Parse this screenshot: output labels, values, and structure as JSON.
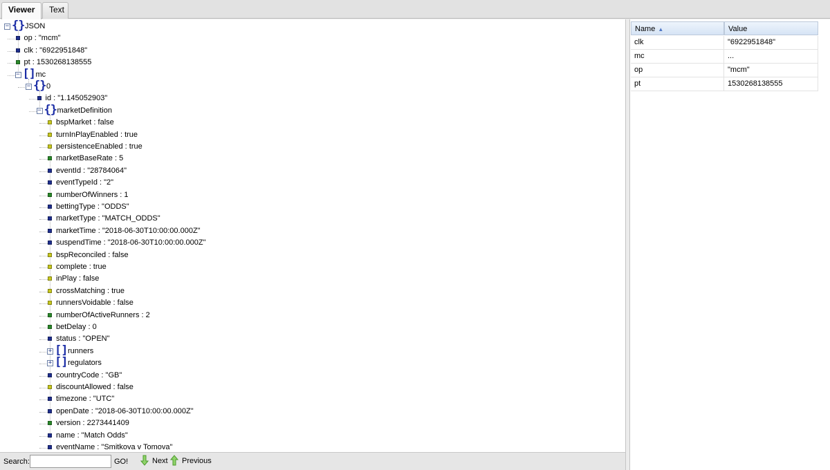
{
  "tabs": [
    {
      "label": "Viewer",
      "active": true
    },
    {
      "label": "Text",
      "active": false
    }
  ],
  "tree": {
    "nodes": [
      {
        "label": "JSON",
        "kind": "object",
        "depth": 0,
        "expanded": true
      },
      {
        "label": "op : \"mcm\"",
        "kind": "string",
        "depth": 1
      },
      {
        "label": "clk : \"6922951848\"",
        "kind": "string",
        "depth": 1
      },
      {
        "label": "pt : 1530268138555",
        "kind": "number",
        "depth": 1
      },
      {
        "label": "mc",
        "kind": "array",
        "depth": 1,
        "expanded": true
      },
      {
        "label": "0",
        "kind": "object",
        "depth": 2,
        "expanded": true
      },
      {
        "label": "id : \"1.145052903\"",
        "kind": "string",
        "depth": 3
      },
      {
        "label": "marketDefinition",
        "kind": "object",
        "depth": 3,
        "expanded": true
      },
      {
        "label": "bspMarket : false",
        "kind": "boolean",
        "depth": 4
      },
      {
        "label": "turnInPlayEnabled : true",
        "kind": "boolean",
        "depth": 4
      },
      {
        "label": "persistenceEnabled : true",
        "kind": "boolean",
        "depth": 4
      },
      {
        "label": "marketBaseRate : 5",
        "kind": "number",
        "depth": 4
      },
      {
        "label": "eventId : \"28784064\"",
        "kind": "string",
        "depth": 4
      },
      {
        "label": "eventTypeId : \"2\"",
        "kind": "string",
        "depth": 4
      },
      {
        "label": "numberOfWinners : 1",
        "kind": "number",
        "depth": 4
      },
      {
        "label": "bettingType : \"ODDS\"",
        "kind": "string",
        "depth": 4
      },
      {
        "label": "marketType : \"MATCH_ODDS\"",
        "kind": "string",
        "depth": 4
      },
      {
        "label": "marketTime : \"2018-06-30T10:00:00.000Z\"",
        "kind": "string",
        "depth": 4
      },
      {
        "label": "suspendTime : \"2018-06-30T10:00:00.000Z\"",
        "kind": "string",
        "depth": 4
      },
      {
        "label": "bspReconciled : false",
        "kind": "boolean",
        "depth": 4
      },
      {
        "label": "complete : true",
        "kind": "boolean",
        "depth": 4
      },
      {
        "label": "inPlay : false",
        "kind": "boolean",
        "depth": 4
      },
      {
        "label": "crossMatching : true",
        "kind": "boolean",
        "depth": 4
      },
      {
        "label": "runnersVoidable : false",
        "kind": "boolean",
        "depth": 4
      },
      {
        "label": "numberOfActiveRunners : 2",
        "kind": "number",
        "depth": 4
      },
      {
        "label": "betDelay : 0",
        "kind": "number",
        "depth": 4
      },
      {
        "label": "status : \"OPEN\"",
        "kind": "string",
        "depth": 4
      },
      {
        "label": "runners",
        "kind": "array",
        "depth": 4,
        "expanded": false
      },
      {
        "label": "regulators",
        "kind": "array",
        "depth": 4,
        "expanded": false
      },
      {
        "label": "countryCode : \"GB\"",
        "kind": "string",
        "depth": 4
      },
      {
        "label": "discountAllowed : false",
        "kind": "boolean",
        "depth": 4
      },
      {
        "label": "timezone : \"UTC\"",
        "kind": "string",
        "depth": 4
      },
      {
        "label": "openDate : \"2018-06-30T10:00:00.000Z\"",
        "kind": "string",
        "depth": 4
      },
      {
        "label": "version : 2273441409",
        "kind": "number",
        "depth": 4
      },
      {
        "label": "name : \"Match Odds\"",
        "kind": "string",
        "depth": 4
      },
      {
        "label": "eventName : \"Smitkova v Tomova\"",
        "kind": "string",
        "depth": 4
      }
    ]
  },
  "search": {
    "label": "Search:",
    "value": "",
    "go_label": "GO!",
    "next_label": "Next",
    "previous_label": "Previous"
  },
  "grid": {
    "header_name": "Name",
    "header_value": "Value",
    "rows": [
      {
        "name": "clk",
        "value": "\"6922951848\""
      },
      {
        "name": "mc",
        "value": "..."
      },
      {
        "name": "op",
        "value": "\"mcm\""
      },
      {
        "name": "pt",
        "value": "1530268138555"
      }
    ]
  },
  "colors": {
    "string": "#1f2f8f",
    "number": "#2a8a2a",
    "boolean": "#c8c81e",
    "container": "#1b2da6"
  }
}
